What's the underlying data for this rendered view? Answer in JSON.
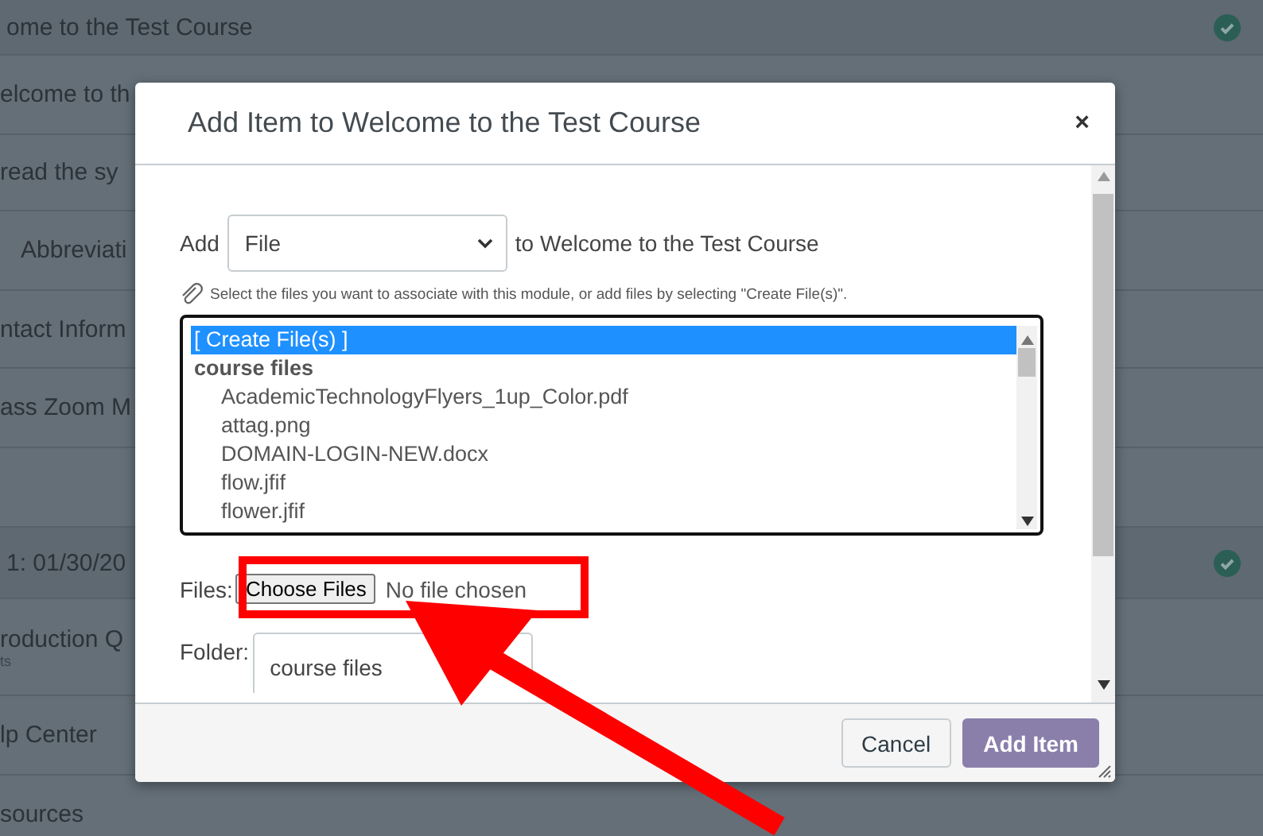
{
  "background_modules": [
    {
      "kind": "header",
      "text": "ome to the Test Course",
      "completed": true
    },
    {
      "kind": "item",
      "text": "elcome to th",
      "completed": false
    },
    {
      "kind": "item",
      "text": "read the sy",
      "completed": false
    },
    {
      "kind": "subitem",
      "text": "Abbreviati",
      "completed": false
    },
    {
      "kind": "item",
      "text": "ntact Inform",
      "completed": false
    },
    {
      "kind": "item",
      "text": "ass Zoom M",
      "completed": false
    },
    {
      "kind": "item",
      "completed": false
    },
    {
      "kind": "header",
      "text": "1: 01/30/20",
      "completed": true
    },
    {
      "kind": "item",
      "text": "roduction Q",
      "subtext": "ts",
      "completed": false
    },
    {
      "kind": "item",
      "text": "lp Center",
      "completed": false
    },
    {
      "kind": "item",
      "text": "sources",
      "completed": false
    }
  ],
  "dialog": {
    "title": "Add Item to Welcome to the Test Course",
    "close": "×",
    "add_label": "Add",
    "item_type": "File",
    "target_text": "to Welcome to the Test Course",
    "hint": "Select the files you want to associate with this module, or add files by selecting \"Create File(s)\".",
    "file_list": [
      {
        "kind": "option",
        "text": "[ Create File(s) ]",
        "selected": true
      },
      {
        "kind": "group",
        "text": "course files",
        "selected": false
      },
      {
        "kind": "file",
        "text": "AcademicTechnologyFlyers_1up_Color.pdf",
        "selected": false
      },
      {
        "kind": "file",
        "text": "attag.png",
        "selected": false
      },
      {
        "kind": "file",
        "text": "DOMAIN-LOGIN-NEW.docx",
        "selected": false
      },
      {
        "kind": "file",
        "text": "flow.jfif",
        "selected": false
      },
      {
        "kind": "file",
        "text": "flower.jfif",
        "selected": false
      }
    ],
    "files_label": "Files:",
    "choose_button": "Choose Files",
    "no_file": "No file chosen",
    "folder_label": "Folder:",
    "folder": "course files",
    "buttons": [
      {
        "kind": "secondary",
        "label": "Cancel"
      },
      {
        "kind": "primary",
        "label": "Add Item"
      }
    ]
  }
}
